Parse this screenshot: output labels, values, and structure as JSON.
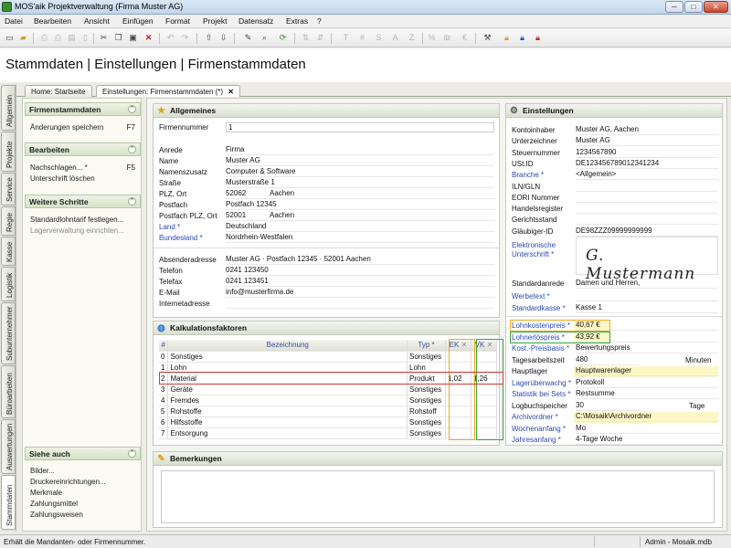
{
  "window": {
    "title": "MOS'aik Projektverwaltung (Firma Muster AG)",
    "min": "─",
    "max": "□",
    "close": "✕"
  },
  "menu": [
    "Datei",
    "Bearbeiten",
    "Ansicht",
    "Einfügen",
    "Format",
    "Projekt",
    "Datensatz",
    "Extras",
    "?"
  ],
  "page_title": "Stammdaten | Einstellungen | Firmenstammdaten",
  "left_tabs": [
    "Allgemein",
    "Projekte",
    "Service",
    "Regie",
    "Kasse",
    "Logistik",
    "Subunternehmer",
    "Büroarbeiten",
    "Auswertungen",
    "Stammdaten"
  ],
  "doc_tabs": [
    "Home: Startseite",
    "Einstellungen: Firmenstammdaten (*)"
  ],
  "doc_tab_close": "✕",
  "sidebar": {
    "sec1": {
      "title": "Firmenstammdaten",
      "items": [
        {
          "label": "Änderungen speichern",
          "key": "F7"
        }
      ]
    },
    "sec2": {
      "title": "Bearbeiten",
      "items": [
        {
          "label": "Nachschlagen... *",
          "key": "F5"
        },
        {
          "label": "Unterschrift löschen",
          "key": ""
        }
      ]
    },
    "sec3": {
      "title": "Weitere Schritte",
      "items": [
        "Standardlohntarif festlegen...",
        "Lagerverwaltung einrichten..."
      ]
    },
    "sec4": {
      "title": "Siehe auch",
      "items": [
        "Bilder...",
        "Druckereinrichtungen...",
        "Merkmale",
        "Zahlungsmittel",
        "Zahlungsweisen"
      ]
    }
  },
  "allgemeines": {
    "title": "Allgemeines",
    "firmennummer_label": "Firmennummer",
    "firmennummer": "1",
    "rows": [
      {
        "label": "Anrede",
        "value": "Firma",
        "blue": false
      },
      {
        "label": "Name",
        "value": "Muster AG",
        "blue": false
      },
      {
        "label": "Namenszusatz",
        "value": "Computer & Software",
        "blue": false
      },
      {
        "label": "Straße",
        "value": "Musterstraße 1",
        "blue": false
      },
      {
        "label": "PLZ, Ort",
        "value": "52062",
        "value2": "Aachen",
        "blue": false
      },
      {
        "label": "Postfach",
        "value": "Postfach 12345",
        "blue": false
      },
      {
        "label": "Postfach PLZ, Ort",
        "value": "52001",
        "value2": "Aachen",
        "blue": false
      },
      {
        "label": "Land *",
        "value": "Deutschland",
        "blue": true
      },
      {
        "label": "Bundesland *",
        "value": "Nordrhein-Westfalen",
        "blue": true
      }
    ],
    "rows2": [
      {
        "label": "Absenderadresse",
        "value": "Muster AG · Postfach 12345 · 52001 Aachen"
      },
      {
        "label": "Telefon",
        "value": "0241 123450"
      },
      {
        "label": "Telefax",
        "value": "0241 123451"
      },
      {
        "label": "E-Mail",
        "value": "info@musterfirma.de"
      },
      {
        "label": "Internetadresse",
        "value": ""
      }
    ]
  },
  "einstellungen": {
    "title": "Einstellungen",
    "rows": [
      {
        "label": "Kontoinhaber",
        "value": "Muster AG, Aachen",
        "blue": false
      },
      {
        "label": "Unterzeichner",
        "value": "Muster AG",
        "blue": false
      },
      {
        "label": "Steuernummer",
        "value": "1234567890",
        "blue": false
      },
      {
        "label": "USt.ID",
        "value": "DE123456789012341234",
        "blue": false
      },
      {
        "label": "Branche *",
        "value": "<Allgemein>",
        "blue": true
      },
      {
        "label": "ILN/GLN",
        "value": "",
        "blue": false
      },
      {
        "label": "EORI Nummer",
        "value": "",
        "blue": false
      },
      {
        "label": "Handelsregister",
        "value": "",
        "blue": false
      },
      {
        "label": "Gerichtsstand",
        "value": "",
        "blue": false
      },
      {
        "label": "Gläubiger-ID",
        "value": "DE98ZZZ09999999999",
        "blue": false
      }
    ],
    "signature_label_1": "Elektronische",
    "signature_label_2": "Unterschrift *",
    "signature": "G. Mustermann",
    "rows2": [
      {
        "label": "Standardanrede",
        "value": "Damen und Herren,",
        "blue": false
      },
      {
        "label": "Werbetext *",
        "value": "",
        "blue": true
      },
      {
        "label": "Standardkasse *",
        "value": "Kasse 1",
        "blue": true
      }
    ],
    "rows3": [
      {
        "label": "Lohnkostenpreis *",
        "value": "40,67 €",
        "blue": true
      },
      {
        "label": "Lohnerlöspreis *",
        "value": "43,92 €",
        "blue": true
      },
      {
        "label": "Kost.-Preisbasis *",
        "value": "Bewertungspreis",
        "blue": true
      },
      {
        "label": "Tagesarbeitszeit",
        "value": "480",
        "unit": "Minuten",
        "blue": false
      },
      {
        "label": "Hauptlager",
        "value": "Hauptwarenlager",
        "blue": false
      },
      {
        "label": "Lagerüberwachg *",
        "value": "Protokoll",
        "blue": true
      },
      {
        "label": "Statistik bei Sets *",
        "value": "Restsumme",
        "blue": true
      },
      {
        "label": "Logbuchspeicher",
        "value": "30",
        "unit": "Tage",
        "blue": false
      },
      {
        "label": "Archivordner *",
        "value": "C:\\Mosaik\\Archivordner",
        "blue": true
      },
      {
        "label": "Wochenanfang *",
        "value": "Mo",
        "blue": true
      },
      {
        "label": "Jahresanfang *",
        "value": "4-Tage Woche",
        "blue": true
      }
    ]
  },
  "kalkulation": {
    "title": "Kalkulationsfaktoren",
    "headers": {
      "num": "#",
      "bez": "Bezeichnung",
      "typ": "Typ *",
      "ek": "EK",
      "vk": "VK",
      "x": "✕"
    },
    "rows": [
      {
        "n": "0",
        "bez": "Sonstiges",
        "typ": "Sonstiges",
        "ek": "",
        "vk": ""
      },
      {
        "n": "1",
        "bez": "Lohn",
        "typ": "Lohn",
        "ek": "",
        "vk": ""
      },
      {
        "n": "2",
        "bez": "Material",
        "typ": "Produkt",
        "ek": "1,02",
        "vk": "1,26"
      },
      {
        "n": "3",
        "bez": "Geräte",
        "typ": "Sonstiges",
        "ek": "",
        "vk": ""
      },
      {
        "n": "4",
        "bez": "Fremdes",
        "typ": "Sonstiges",
        "ek": "",
        "vk": ""
      },
      {
        "n": "5",
        "bez": "Rohstoffe",
        "typ": "Rohstoff",
        "ek": "",
        "vk": ""
      },
      {
        "n": "6",
        "bez": "Hilfsstoffe",
        "typ": "Sonstiges",
        "ek": "",
        "vk": ""
      },
      {
        "n": "7",
        "bez": "Entsorgung",
        "typ": "Sonstiges",
        "ek": "",
        "vk": ""
      }
    ]
  },
  "bemerkungen": {
    "title": "Bemerkungen",
    "text": ""
  },
  "status": {
    "left": "Erhält die Mandanten- oder Firmennummer.",
    "right": "Admin - Mosaik.mdb"
  },
  "colors": {
    "accent_green": "#3aa53a",
    "accent_orange": "#f0a81e",
    "accent_red": "#d23a3a",
    "link_blue": "#2a49b8"
  }
}
